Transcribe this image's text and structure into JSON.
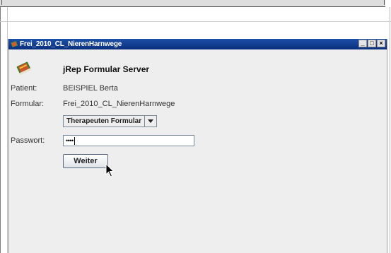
{
  "window": {
    "title": "Frei_2010_CL_NierenHarnwege",
    "controls": {
      "minimize": "_",
      "maximize": "□",
      "close": "×"
    }
  },
  "form": {
    "heading": "jRep Formular Server",
    "patient_label": "Patient:",
    "patient_value": "BEISPIEL Berta",
    "formular_label": "Formular:",
    "formular_value": "Frei_2010_CL_NierenHarnwege",
    "form_type_selected": "Therapeuten Formular",
    "password_label": "Passwort:",
    "password_value": "••••",
    "continue_button": "Weiter"
  },
  "colors": {
    "titlebar": "#0a2f7d",
    "window_bg": "#eeeeee"
  },
  "icons": [
    "app-book-icon",
    "combo-arrow-icon",
    "mouse-pointer-icon"
  ]
}
